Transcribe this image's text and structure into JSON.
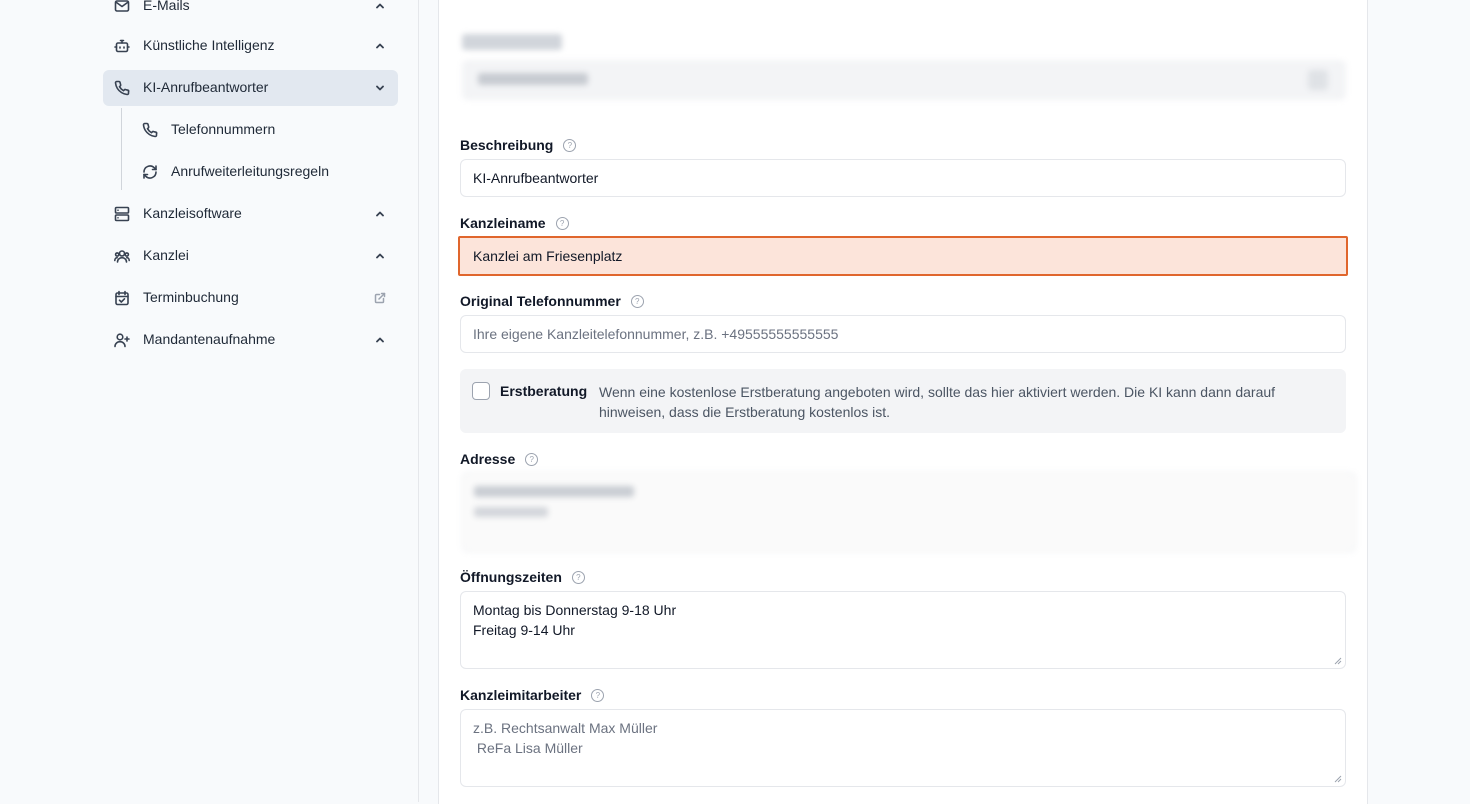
{
  "sidebar": {
    "items": [
      {
        "label": "E-Mails",
        "icon": "mail-icon",
        "chevron": "chevron-up-icon"
      },
      {
        "label": "Künstliche Intelligenz",
        "icon": "bot-icon",
        "chevron": "chevron-up-icon"
      },
      {
        "label": "KI-Anrufbeantworter",
        "icon": "phone-icon",
        "chevron": "chevron-down-icon",
        "active": true
      },
      {
        "label": "Kanzleisoftware",
        "icon": "server-icon",
        "chevron": "chevron-up-icon"
      },
      {
        "label": "Kanzlei",
        "icon": "users-icon",
        "chevron": "chevron-up-icon"
      },
      {
        "label": "Terminbuchung",
        "icon": "calendar-check-icon",
        "chevron": "external-link-icon"
      },
      {
        "label": "Mandantenaufnahme",
        "icon": "user-plus-icon",
        "chevron": "chevron-up-icon"
      }
    ],
    "subitems": [
      {
        "label": "Telefonnummern",
        "icon": "phone-icon"
      },
      {
        "label": "Anrufweiterleitungsregeln",
        "icon": "refresh-icon"
      }
    ]
  },
  "form": {
    "beschreibung": {
      "label": "Beschreibung",
      "value": "KI-Anrufbeantworter"
    },
    "kanzleiname": {
      "label": "Kanzleiname",
      "value": "Kanzlei am Friesenplatz"
    },
    "telefon": {
      "label": "Original Telefonnummer",
      "placeholder": "Ihre eigene Kanzleitelefonnummer, z.B. +49555555555555"
    },
    "erstberatung": {
      "label": "Erstberatung",
      "description": "Wenn eine kostenlose Erstberatung angeboten wird, sollte das hier aktiviert werden. Die KI kann dann darauf hinweisen, dass die Erstberatung kostenlos ist."
    },
    "adresse": {
      "label": "Adresse"
    },
    "oeffnungszeiten": {
      "label": "Öffnungszeiten",
      "value": "Montag bis Donnerstag 9-18 Uhr\nFreitag 9-14 Uhr"
    },
    "mitarbeiter": {
      "label": "Kanzleimitarbeiter",
      "placeholder": "z.B. Rechtsanwalt Max Müller\n ReFa Lisa Müller"
    }
  },
  "colors": {
    "highlight_bg": "#fce4da",
    "highlight_border": "#e0662d",
    "active_nav": "#e2e8f0"
  }
}
